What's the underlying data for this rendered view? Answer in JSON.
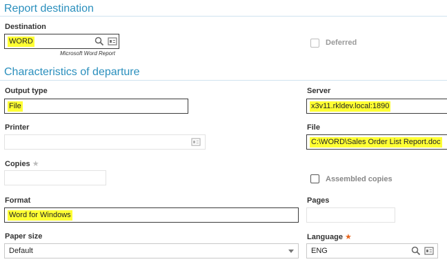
{
  "sections": {
    "report_destination": "Report destination",
    "characteristics": "Characteristics of departure"
  },
  "destination": {
    "label": "Destination",
    "value": "WORD",
    "description": "Microsoft Word Report"
  },
  "deferred": {
    "label": "Deferred",
    "checked": false
  },
  "output_type": {
    "label": "Output type",
    "value": "File"
  },
  "server": {
    "label": "Server",
    "value": "x3v11.rkldev.local:1890"
  },
  "printer": {
    "label": "Printer",
    "value": ""
  },
  "file": {
    "label": "File",
    "value": "C:\\WORD\\Sales Order List Report.doc"
  },
  "copies": {
    "label": "Copies",
    "mark": "★",
    "value": ""
  },
  "assembled_copies": {
    "label": "Assembled copies",
    "checked": false
  },
  "format": {
    "label": "Format",
    "value": "Word for Windows"
  },
  "pages": {
    "label": "Pages",
    "value": ""
  },
  "paper_size": {
    "label": "Paper size",
    "value": "Default"
  },
  "language": {
    "label": "Language",
    "mark": "★",
    "value": "ENG"
  },
  "colors": {
    "accent": "#2a8fbd",
    "highlight": "#ffff33",
    "required": "#e8641b"
  }
}
